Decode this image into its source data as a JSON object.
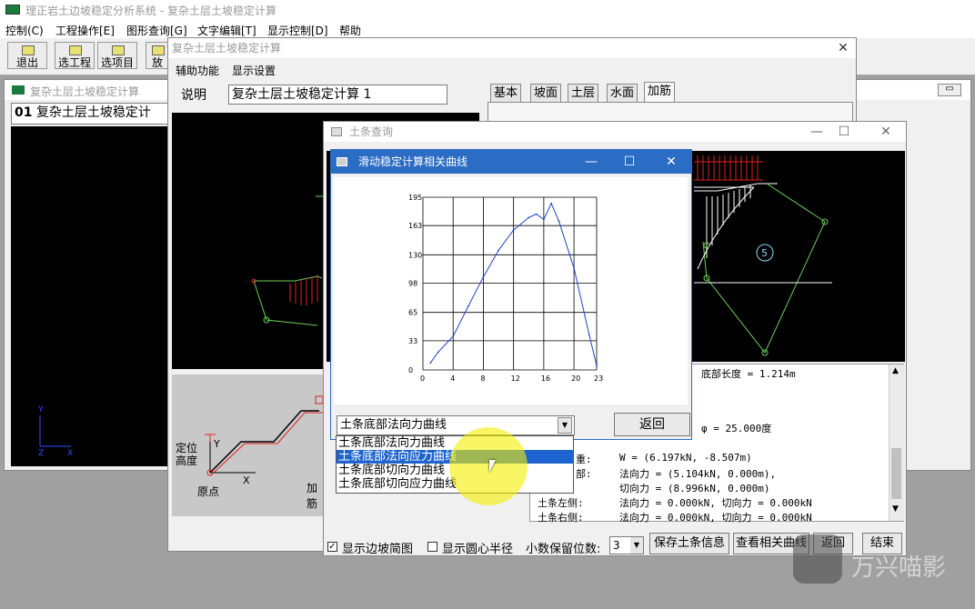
{
  "app": {
    "title": "理正岩土边坡稳定分析系统 - 复杂土层土坡稳定计算",
    "menu": [
      "控制(C)",
      "工程操作[E]",
      "图形查询[G]",
      "文字编辑[T]",
      "显示控制[D]",
      "帮助"
    ],
    "toolbar": [
      "退出",
      "选工程",
      "选项目",
      "放"
    ]
  },
  "left_window": {
    "title": "复杂土层土坡稳定计算",
    "item_num": "01",
    "item_text": "复杂土层土坡稳定计"
  },
  "calc_window": {
    "title": "复杂土层土坡稳定计算",
    "menu": [
      "辅助功能",
      "显示设置"
    ],
    "desc_label": "说明",
    "desc_value": "复杂土层土坡稳定计算 1",
    "tabs": [
      "基本",
      "坡面",
      "土层",
      "水面",
      "加筋"
    ],
    "diagram_labels": [
      "定位",
      "高度",
      "Y",
      "X",
      "原点",
      "加筋"
    ]
  },
  "soil_window": {
    "title": "土条查询",
    "circle_number": "5",
    "info_lines": [
      "底部长度 = 1.214m",
      "φ = 25.000度",
      "W = (6.197kN, -8.507m)",
      "法向力 = (5.104kN, 0.000m),",
      "切向力 = (8.996kN, 0.000m)",
      "土条左侧:",
      "法向力 = 0.000kN, 切向力 = 0.000kN",
      "土条右侧:",
      "法向力 = 0.000kN, 切向力 = 0.000kN"
    ],
    "info_partial": [
      "重:",
      "部:"
    ],
    "bottom": {
      "show_slope_label": "显示边坡简图",
      "show_slope_checked": true,
      "show_radius_label": "显示圆心半径",
      "show_radius_checked": false,
      "decimals_label": "小数保留位数:",
      "decimals_value": "3",
      "save_button": "保存土条信息",
      "view_curve_button": "查看相关曲线",
      "return_button": "返回",
      "end_button": "结束"
    }
  },
  "curve_dialog": {
    "title": "滑动稳定计算相关曲线",
    "return_button": "返回",
    "dropdown_value": "土条底部法向力曲线",
    "dropdown_options": [
      "土条底部法向力曲线",
      "土条底部法向应力曲线",
      "土条底部切向力曲线",
      "土条底部切向应力曲线"
    ],
    "selected_index": 1
  },
  "chart_data": {
    "type": "line",
    "xlabel": "",
    "ylabel": "",
    "x_ticks": [
      0,
      4,
      8,
      12,
      16,
      20,
      23
    ],
    "y_ticks": [
      0,
      33,
      65,
      98,
      130,
      163,
      195
    ],
    "xlim": [
      0,
      23
    ],
    "ylim": [
      0,
      195
    ],
    "grid": true,
    "x": [
      1,
      2,
      4,
      6,
      8,
      10,
      12,
      14,
      15,
      16,
      17,
      18,
      20,
      22,
      23
    ],
    "y": [
      8,
      20,
      38,
      72,
      105,
      135,
      158,
      172,
      176,
      170,
      188,
      168,
      115,
      40,
      5
    ]
  },
  "watermark": "万兴喵影",
  "colors": {
    "active_title": "#2b6cc4",
    "selection": "#1e64d0",
    "highlight": "#f5f000",
    "diagram_green": "#6ccf5a",
    "diagram_red": "#e02020",
    "diagram_cyan": "#8fd8ff"
  }
}
